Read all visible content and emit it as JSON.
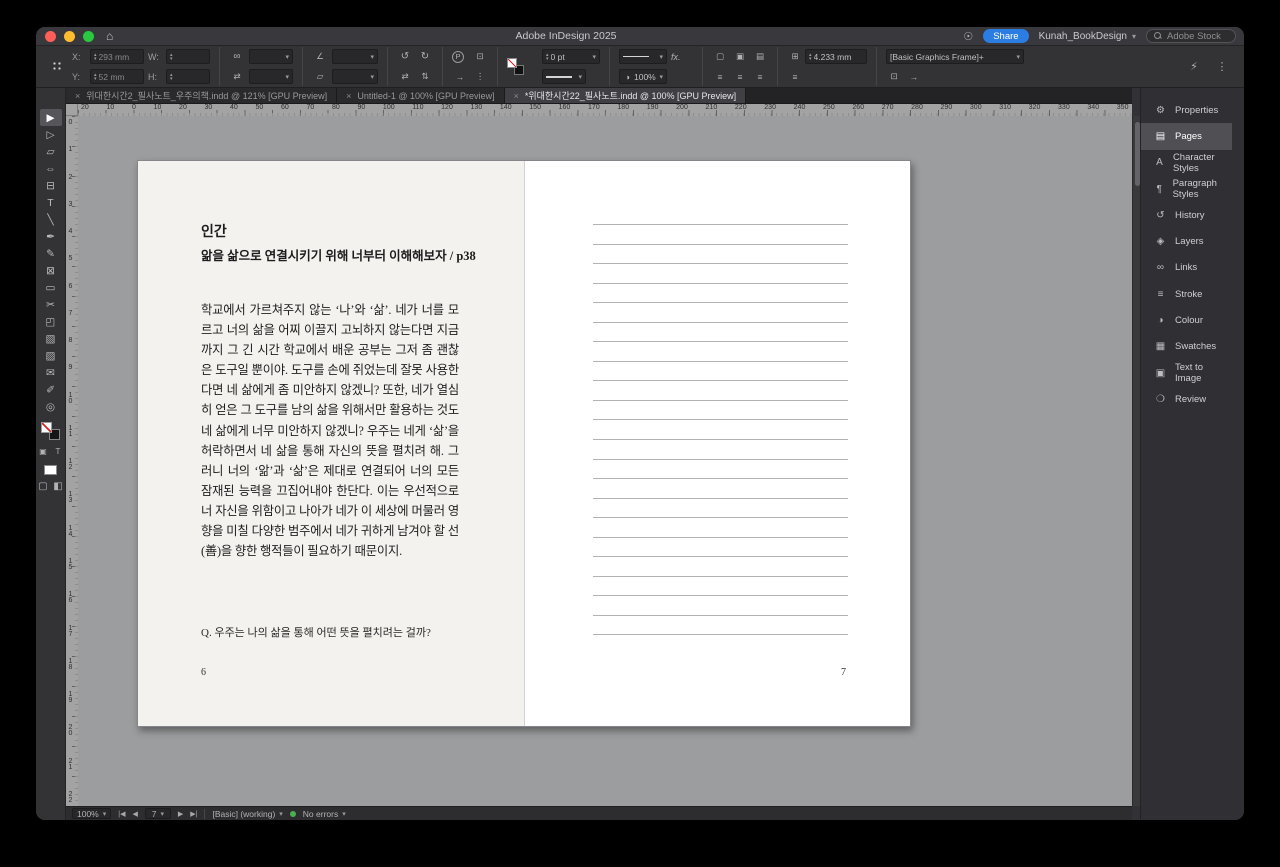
{
  "app": {
    "title": "Adobe InDesign 2025",
    "share_label": "Share",
    "workspace": "Kunah_BookDesign",
    "stock_search": "Adobe Stock"
  },
  "colors": {
    "accent_blue": "#2b7de1",
    "preflight_green": "#4caf50",
    "traffic_red": "#ff5f57",
    "traffic_yellow": "#febc2e",
    "traffic_green": "#2ac840"
  },
  "icons": {
    "home": "⌂",
    "bulb": "☉",
    "chevron": "▾",
    "close": "×",
    "stepper_up": "▴",
    "stepper_down": "▾",
    "chain": "∞",
    "rotate_ccw": "↺",
    "rotate_cw": "↻",
    "flip_h": "⇄",
    "flip_v": "⇅",
    "angle": "∠",
    "shear": "▱",
    "p_badge": "P",
    "wrap_1": "▢",
    "wrap_2": "▣",
    "wrap_3": "▤",
    "align_1": "≡",
    "corner": "⊞",
    "container": "⊡",
    "content_arrow": "→",
    "opacity": "◑",
    "lightning": "⚡",
    "dots": "⋮",
    "nav_first": "|◀",
    "nav_prev": "◀",
    "nav_next": "▶",
    "nav_last": "▶|"
  },
  "control_panel": {
    "x_label": "X:",
    "x_value": "293 mm",
    "y_label": "Y:",
    "y_value": "52 mm",
    "w_label": "W:",
    "w_value": "",
    "h_label": "H:",
    "h_value": "",
    "stroke_weight": "0 pt",
    "fx_label": "fx.",
    "opacity_value": "100%",
    "corner_value": "4.233 mm",
    "object_style": "[Basic Graphics Frame]+"
  },
  "tabs": [
    {
      "name": "document-tab",
      "label": "위대한시간2_필사노트_우주의책.indd @ 121% [GPU Preview]",
      "active": false
    },
    {
      "name": "document-tab",
      "label": "Untitled-1 @ 100% [GPU Preview]",
      "active": false
    },
    {
      "name": "document-tab",
      "label": "*위대한시간22_필사노트.indd @ 100% [GPU Preview]",
      "active": true
    }
  ],
  "rulers": {
    "horizontal": [
      "20",
      "10",
      "0",
      "10",
      "20",
      "30",
      "40",
      "50",
      "60",
      "70",
      "80",
      "90",
      "100",
      "110",
      "120",
      "130",
      "140",
      "150",
      "160",
      "170",
      "180",
      "190",
      "200",
      "210",
      "220",
      "230",
      "240",
      "250",
      "260",
      "270",
      "280",
      "290",
      "300",
      "310",
      "320",
      "330",
      "340",
      "350"
    ],
    "vertical": [
      "0",
      "1",
      "2",
      "3",
      "4",
      "5",
      "6",
      "7",
      "8",
      "9",
      "10",
      "11",
      "12",
      "13",
      "14",
      "15",
      "16",
      "17",
      "18",
      "19",
      "20",
      "21",
      "22"
    ]
  },
  "tools": [
    {
      "name": "selection-tool",
      "glyph": "▶",
      "active": true
    },
    {
      "name": "direct-selection-tool",
      "glyph": "▷",
      "active": false
    },
    {
      "name": "page-tool",
      "glyph": "▱",
      "active": false
    },
    {
      "name": "gap-tool",
      "glyph": "⇔",
      "active": false
    },
    {
      "name": "content-collector-tool",
      "glyph": "⊟",
      "active": false
    },
    {
      "name": "type-tool",
      "glyph": "T",
      "active": false
    },
    {
      "name": "line-tool",
      "glyph": "╲",
      "active": false
    },
    {
      "name": "pen-tool",
      "glyph": "✒",
      "active": false
    },
    {
      "name": "pencil-tool",
      "glyph": "✎",
      "active": false
    },
    {
      "name": "rectangle-frame-tool",
      "glyph": "⊠",
      "active": false
    },
    {
      "name": "rectangle-tool",
      "glyph": "▭",
      "active": false
    },
    {
      "name": "scissors-tool",
      "glyph": "✂",
      "active": false
    },
    {
      "name": "free-transform-tool",
      "glyph": "◰",
      "active": false
    },
    {
      "name": "gradient-swatch-tool",
      "glyph": "▧",
      "active": false
    },
    {
      "name": "gradient-feather-tool",
      "glyph": "▨",
      "active": false
    },
    {
      "name": "note-tool",
      "glyph": "✉",
      "active": false
    },
    {
      "name": "eyedropper-tool",
      "glyph": "✐",
      "active": false
    },
    {
      "name": "zoom-tool",
      "glyph": "◎",
      "active": false
    }
  ],
  "tools_bottom": [
    {
      "name": "formatting-affects-container-button",
      "glyph": "▣"
    },
    {
      "name": "formatting-affects-text-button",
      "glyph": "T"
    }
  ],
  "view_tools": [
    {
      "name": "normal-view-mode-button",
      "glyph": "▢"
    },
    {
      "name": "screen-mode-button",
      "glyph": "◧"
    }
  ],
  "panels": [
    {
      "name": "panel-tab-properties",
      "label": "Properties",
      "glyph": "⚙",
      "active": false
    },
    {
      "name": "panel-tab-pages",
      "label": "Pages",
      "glyph": "▤",
      "active": true
    },
    {
      "name": "panel-tab-character-styles",
      "label": "Character Styles",
      "glyph": "A",
      "active": false
    },
    {
      "name": "panel-tab-paragraph-styles",
      "label": "Paragraph Styles",
      "glyph": "¶",
      "active": false
    },
    {
      "name": "panel-tab-history",
      "label": "History",
      "glyph": "↺",
      "active": false
    },
    {
      "name": "panel-tab-layers",
      "label": "Layers",
      "glyph": "◈",
      "active": false
    },
    {
      "name": "panel-tab-links",
      "label": "Links",
      "glyph": "∞",
      "active": false
    },
    {
      "name": "panel-tab-stroke",
      "label": "Stroke",
      "glyph": "≡",
      "active": false
    },
    {
      "name": "panel-tab-colour",
      "label": "Colour",
      "glyph": "◑",
      "active": false
    },
    {
      "name": "panel-tab-swatches",
      "label": "Swatches",
      "glyph": "▦",
      "active": false
    },
    {
      "name": "panel-tab-text-to-image",
      "label": "Text to Image",
      "glyph": "▣",
      "active": false
    },
    {
      "name": "panel-tab-review",
      "label": "Review",
      "glyph": "❍",
      "active": false
    }
  ],
  "document": {
    "left_page": {
      "title": "인간",
      "subtitle": "앎을 삶으로 연결시키기 위해 너부터 이해해보자 / p38",
      "body": "학교에서 가르쳐주지 않는 ‘나’와 ‘삶’. 네가 너를 모르고 너의 삶을 어찌 이끌지 고뇌하지 않는다면 지금까지 그 긴 시간 학교에서 배운 공부는 그저 좀 괜찮은 도구일 뿐이야. 도구를 손에 쥐었는데 잘못 사용한다면 네 삶에게 좀 미안하지 않겠니? 또한, 네가 열심히 얻은 그 도구를 남의 삶을 위해서만 활용하는 것도 네 삶에게 너무 미안하지 않겠니? 우주는 네게 ‘삶’을 허락하면서 네 삶을 통해 자신의 뜻을 펼치려 해. 그러니 너의 ‘앎’과 ‘삶’은 제대로 연결되어 너의 모든 잠재된 능력을 끄집어내야 한단다. 이는 우선적으로 너 자신을 위함이고 나아가 네가 이 세상에 머물러 영향을 미칠 다양한 범주에서 네가 귀하게 남겨야 할 선(善)을 향한 행적들이 필요하기 때문이지.",
      "question": "Q. 우주는 나의 삶을 통해 어떤 뜻을 펼치려는 걸까?",
      "page_number": "6"
    },
    "right_page": {
      "ruled_lines_count": 22,
      "page_number": "7"
    }
  },
  "status_bar": {
    "zoom": "100%",
    "page": "7",
    "preflight_profile": "[Basic] (working)",
    "preflight_status": "No errors"
  }
}
